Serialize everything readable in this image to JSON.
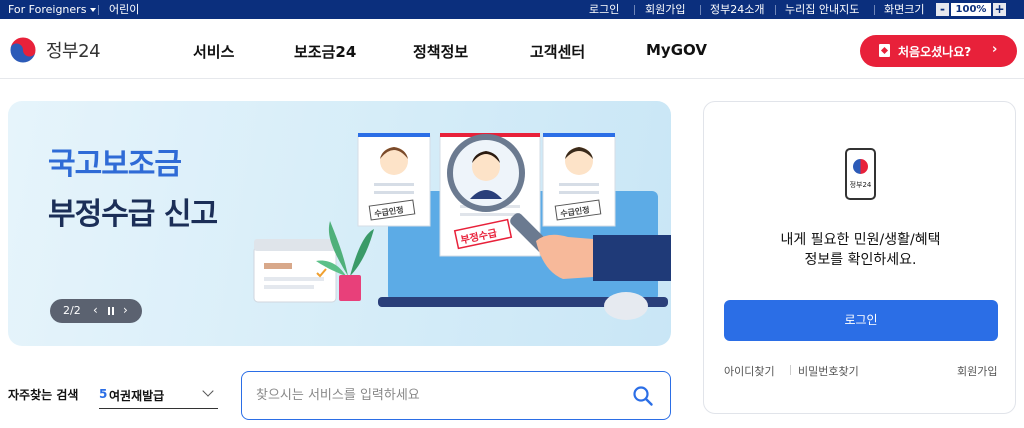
{
  "topbar": {
    "for_foreigners": "For Foreigners",
    "kids": "어린이",
    "login": "로그인",
    "signup": "회원가입",
    "about": "정부24소개",
    "sitemap": "누리집 안내지도",
    "screen_size": "화면크기",
    "zoom_minus": "-",
    "zoom_value": "100%",
    "zoom_plus": "+"
  },
  "header": {
    "logo_text": "정부24",
    "nav": [
      "서비스",
      "보조금24",
      "정책정보",
      "고객센터",
      "MyGOV"
    ],
    "first_visit": "처음오셨나요?",
    "first_visit_chevron": "›"
  },
  "banner": {
    "title_line1": "국고보조금",
    "title_line2": "부정수급 신고",
    "stamp_left": "수급인정",
    "stamp_center": "부정수급",
    "stamp_right": "수급인정",
    "slide_current": "2/2",
    "prev": "‹",
    "next": "›"
  },
  "login": {
    "icon_label": "정부24",
    "message_line1": "내게 필요한 민원/생활/혜택",
    "message_line2": "정보를 확인하세요.",
    "button": "로그인",
    "find_id": "아이디찾기",
    "find_pw": "비밀번호찾기",
    "signup": "회원가입"
  },
  "search": {
    "freq_label": "자주찾는 검색",
    "freq_rank": "5",
    "freq_term": "여권재발급",
    "placeholder": "찾으시는 서비스를 입력하세요"
  },
  "colors": {
    "topbar": "#0b2f7d",
    "accent_red": "#e8213a",
    "primary_blue": "#2b6ee6",
    "banner_title_blue": "#2f6bd6",
    "banner_title_navy": "#1b2e57"
  }
}
